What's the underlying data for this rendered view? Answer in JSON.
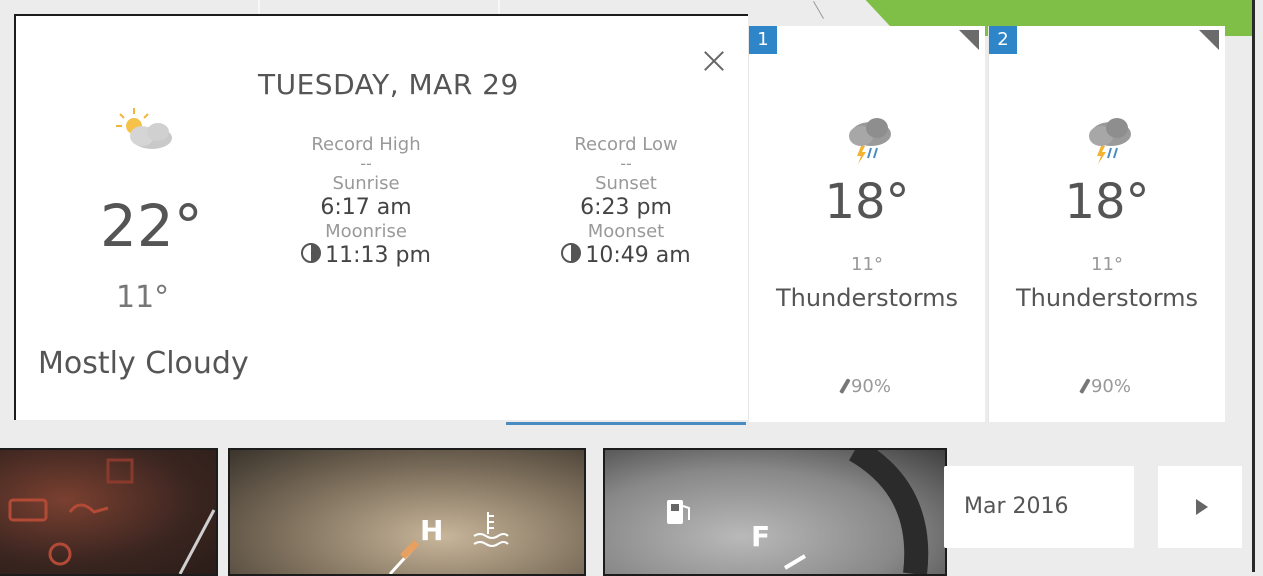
{
  "panel": {
    "date": "TUESDAY, MAR 29",
    "high": "22°",
    "low": "11°",
    "condition": "Mostly Cloudy",
    "weather_icon": "partly-cloudy-icon",
    "close_icon": "close-icon",
    "record_high_label": "Record High",
    "record_high_value": "--",
    "record_low_label": "Record Low",
    "record_low_value": "--",
    "sunrise_label": "Sunrise",
    "sunrise_value": "6:17 am",
    "sunset_label": "Sunset",
    "sunset_value": "6:23 pm",
    "moonrise_label": "Moonrise",
    "moonrise_value": "11:13 pm",
    "moonset_label": "Moonset",
    "moonset_value": "10:49 am"
  },
  "forecast": [
    {
      "badge": "1",
      "temp": "18°",
      "low": "11°",
      "condition": "Thunderstorms",
      "precip": "90%",
      "icon": "thunderstorm-icon"
    },
    {
      "badge": "2",
      "temp": "18°",
      "low": "11°",
      "condition": "Thunderstorms",
      "precip": "90%",
      "icon": "thunderstorm-icon"
    }
  ],
  "month_selector": {
    "label": "Mar 2016"
  },
  "next_icon": "play-arrow-icon",
  "photos": {
    "p2_letter": "H",
    "p3_letter": "F"
  },
  "colors": {
    "accent_blue": "#2e86c9",
    "active_tab_underline": "#4a8bc2",
    "green_decoration": "#7fbf48"
  }
}
